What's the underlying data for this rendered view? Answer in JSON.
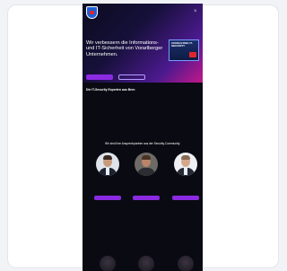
{
  "hero": {
    "headline": "Wir verbessern die Informations- und IT-Sicherheit von Vorarlberger Unternehmen.",
    "product_title": "CONSULTING IT-SECURITY",
    "primary_button": "",
    "secondary_button": ""
  },
  "about": {
    "title": "Die IT-Security Experten aus Bern",
    "text": ""
  },
  "team": {
    "heading": "Wir sind Ihre Ansprechpartner aus der Security-Community.",
    "members": [
      {
        "name": "",
        "role": "",
        "button": ""
      },
      {
        "name": "",
        "role": "",
        "button": ""
      },
      {
        "name": "",
        "role": "",
        "button": ""
      }
    ]
  },
  "colors": {
    "accent": "#8a2be2",
    "hero_gradient_end": "#c2178a",
    "background": "#0a0a12"
  },
  "icons": {
    "logo": "shield-logo-icon",
    "menu": "menu-icon"
  }
}
